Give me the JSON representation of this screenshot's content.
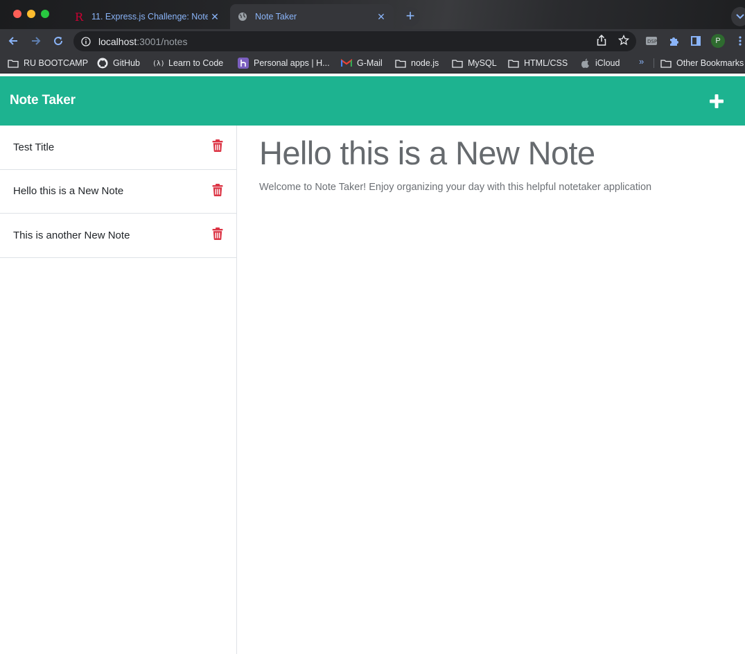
{
  "browser": {
    "tabs": [
      {
        "title": "11. Express.js Challenge: Note",
        "favicon": "rutgers-r-icon",
        "active": false
      },
      {
        "title": "Note Taker",
        "favicon": "globe-icon",
        "active": true
      }
    ],
    "new_tab_label": "+",
    "address": {
      "host": "localhost",
      "rest": ":3001/notes"
    },
    "profile_initial": "P",
    "bookmarks": [
      {
        "label": "RU BOOTCAMP",
        "icon": "folder-icon"
      },
      {
        "label": "GitHub",
        "icon": "github-icon"
      },
      {
        "label": "Learn to Code",
        "icon": "code-icon"
      },
      {
        "label": "Personal apps | H...",
        "icon": "heroku-icon"
      },
      {
        "label": "G-Mail",
        "icon": "gmail-icon"
      },
      {
        "label": "node.js",
        "icon": "folder-icon"
      },
      {
        "label": "MySQL",
        "icon": "folder-icon"
      },
      {
        "label": "HTML/CSS",
        "icon": "folder-icon"
      },
      {
        "label": "iCloud",
        "icon": "apple-icon"
      }
    ],
    "bookmarks_overflow": "»",
    "other_bookmarks": "Other Bookmarks"
  },
  "app": {
    "brand": "Note Taker",
    "colors": {
      "navbar": "#1db390",
      "delete": "#dc3545"
    },
    "notes": [
      {
        "title": "Test Title"
      },
      {
        "title": "Hello this is a New Note"
      },
      {
        "title": "This is another New Note"
      }
    ],
    "active_note": {
      "title": "Hello this is a New Note",
      "text": "Welcome to Note Taker! Enjoy organizing your day with this helpful notetaker application"
    }
  }
}
